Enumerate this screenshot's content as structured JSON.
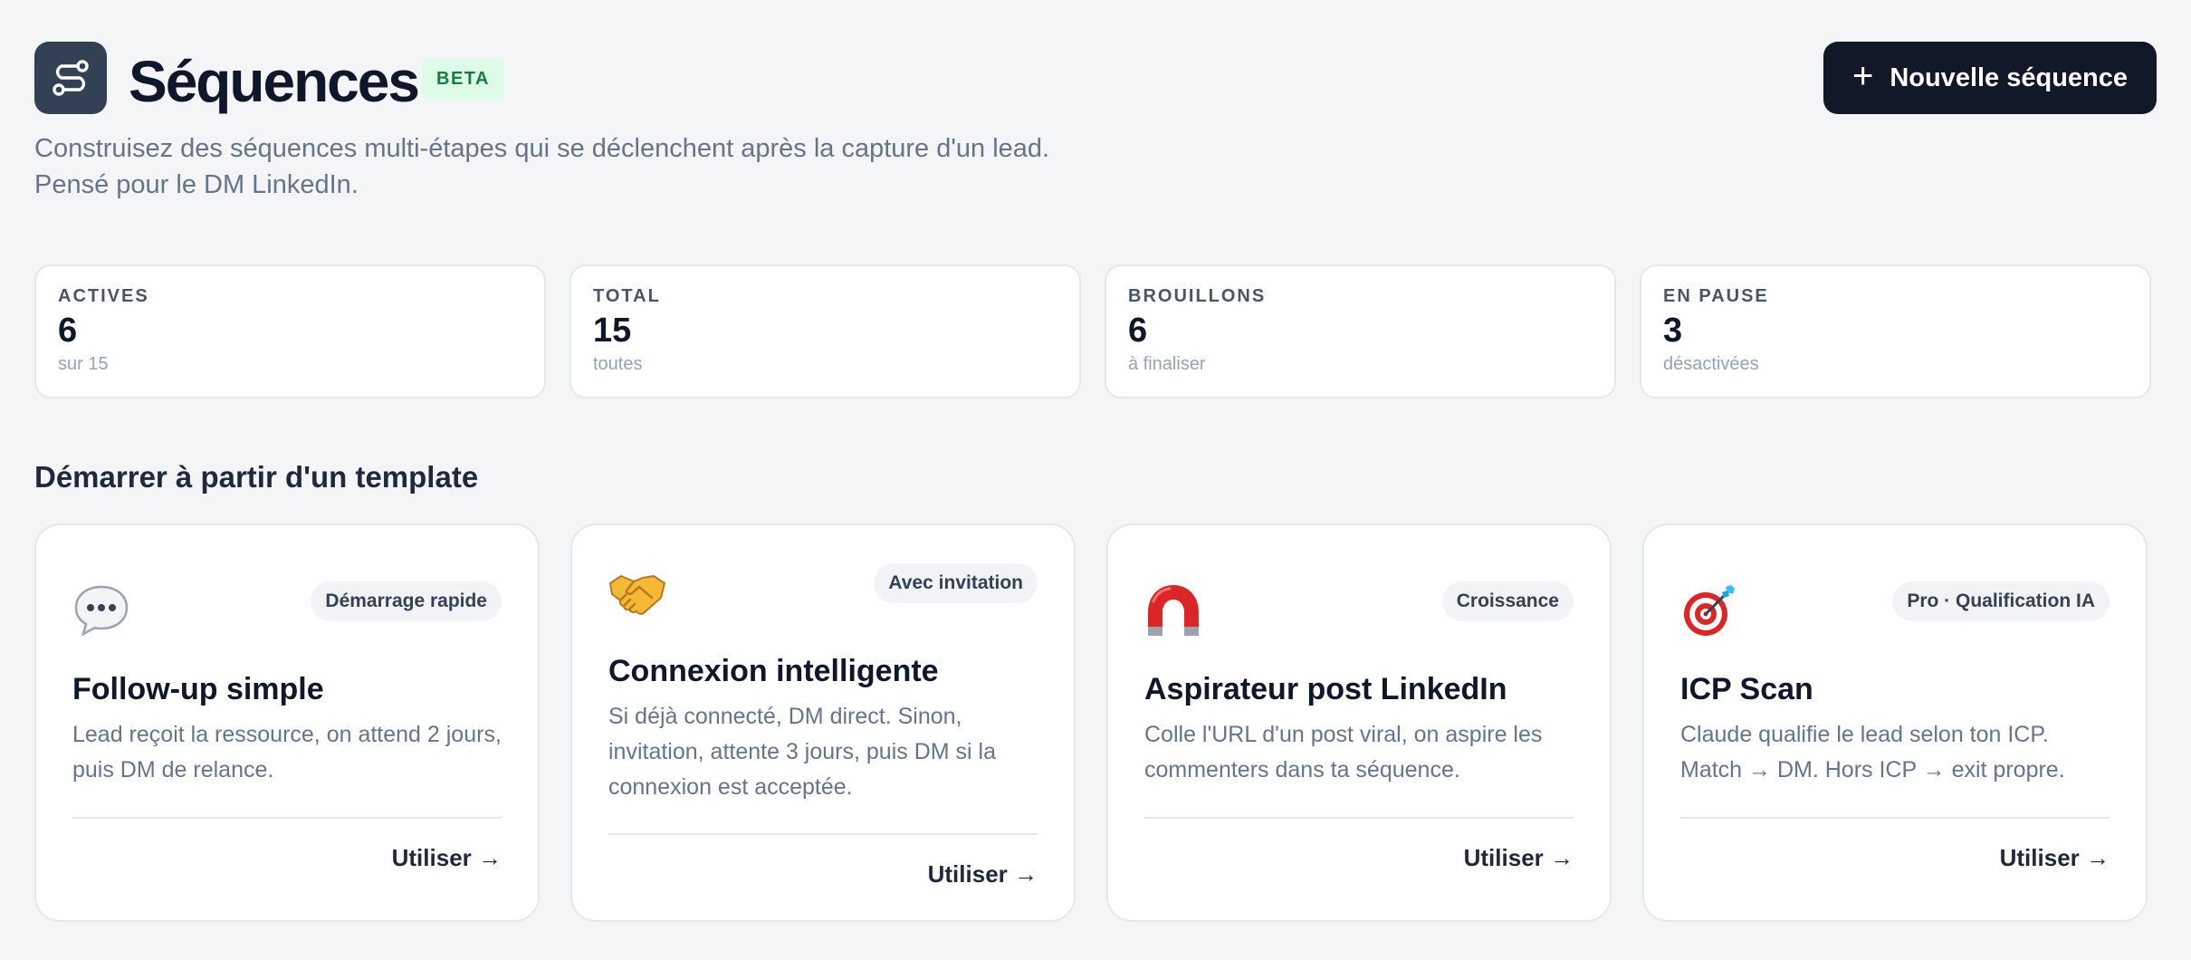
{
  "header": {
    "title": "Séquences",
    "badge": "BETA",
    "logo_icon": "route-icon",
    "new_button_label": "Nouvelle séquence",
    "new_button_icon": "plus-icon",
    "subtitle_line1": "Construisez des séquences multi-étapes qui se déclenchent après la capture d'un lead.",
    "subtitle_line2": "Pensé pour le DM LinkedIn."
  },
  "stats": [
    {
      "label": "ACTIVES",
      "value": "6",
      "sub": "sur 15"
    },
    {
      "label": "TOTAL",
      "value": "15",
      "sub": "toutes"
    },
    {
      "label": "BROUILLONS",
      "value": "6",
      "sub": "à finaliser"
    },
    {
      "label": "EN PAUSE",
      "value": "3",
      "sub": "désactivées"
    }
  ],
  "templates_section": {
    "title": "Démarrer à partir d'un template",
    "items": [
      {
        "icon": "speech-bubble-icon",
        "badge": "Démarrage rapide",
        "title": "Follow-up simple",
        "description": "Lead reçoit la ressource, on attend 2 jours, puis DM de relance.",
        "action": "Utiliser →"
      },
      {
        "icon": "handshake-icon",
        "badge": "Avec invitation",
        "title": "Connexion intelligente",
        "description": "Si déjà connecté, DM direct. Sinon, invitation, attente 3 jours, puis DM si la connexion est acceptée.",
        "action": "Utiliser →"
      },
      {
        "icon": "magnet-icon",
        "badge": "Croissance",
        "title": "Aspirateur post LinkedIn",
        "description": "Colle l'URL d'un post viral, on aspire les commenters dans ta séquence.",
        "action": "Utiliser →"
      },
      {
        "icon": "target-icon",
        "badge": "Pro · Qualification IA",
        "title": "ICP Scan",
        "description": "Claude qualifie le lead selon ton ICP. Match → DM. Hors ICP → exit propre.",
        "action": "Utiliser →"
      }
    ]
  },
  "colors": {
    "background": "#f4f5f7",
    "primary_button": "#111827",
    "logo_box": "#334155",
    "beta_bg": "#dcfce7",
    "beta_text": "#15803d"
  }
}
